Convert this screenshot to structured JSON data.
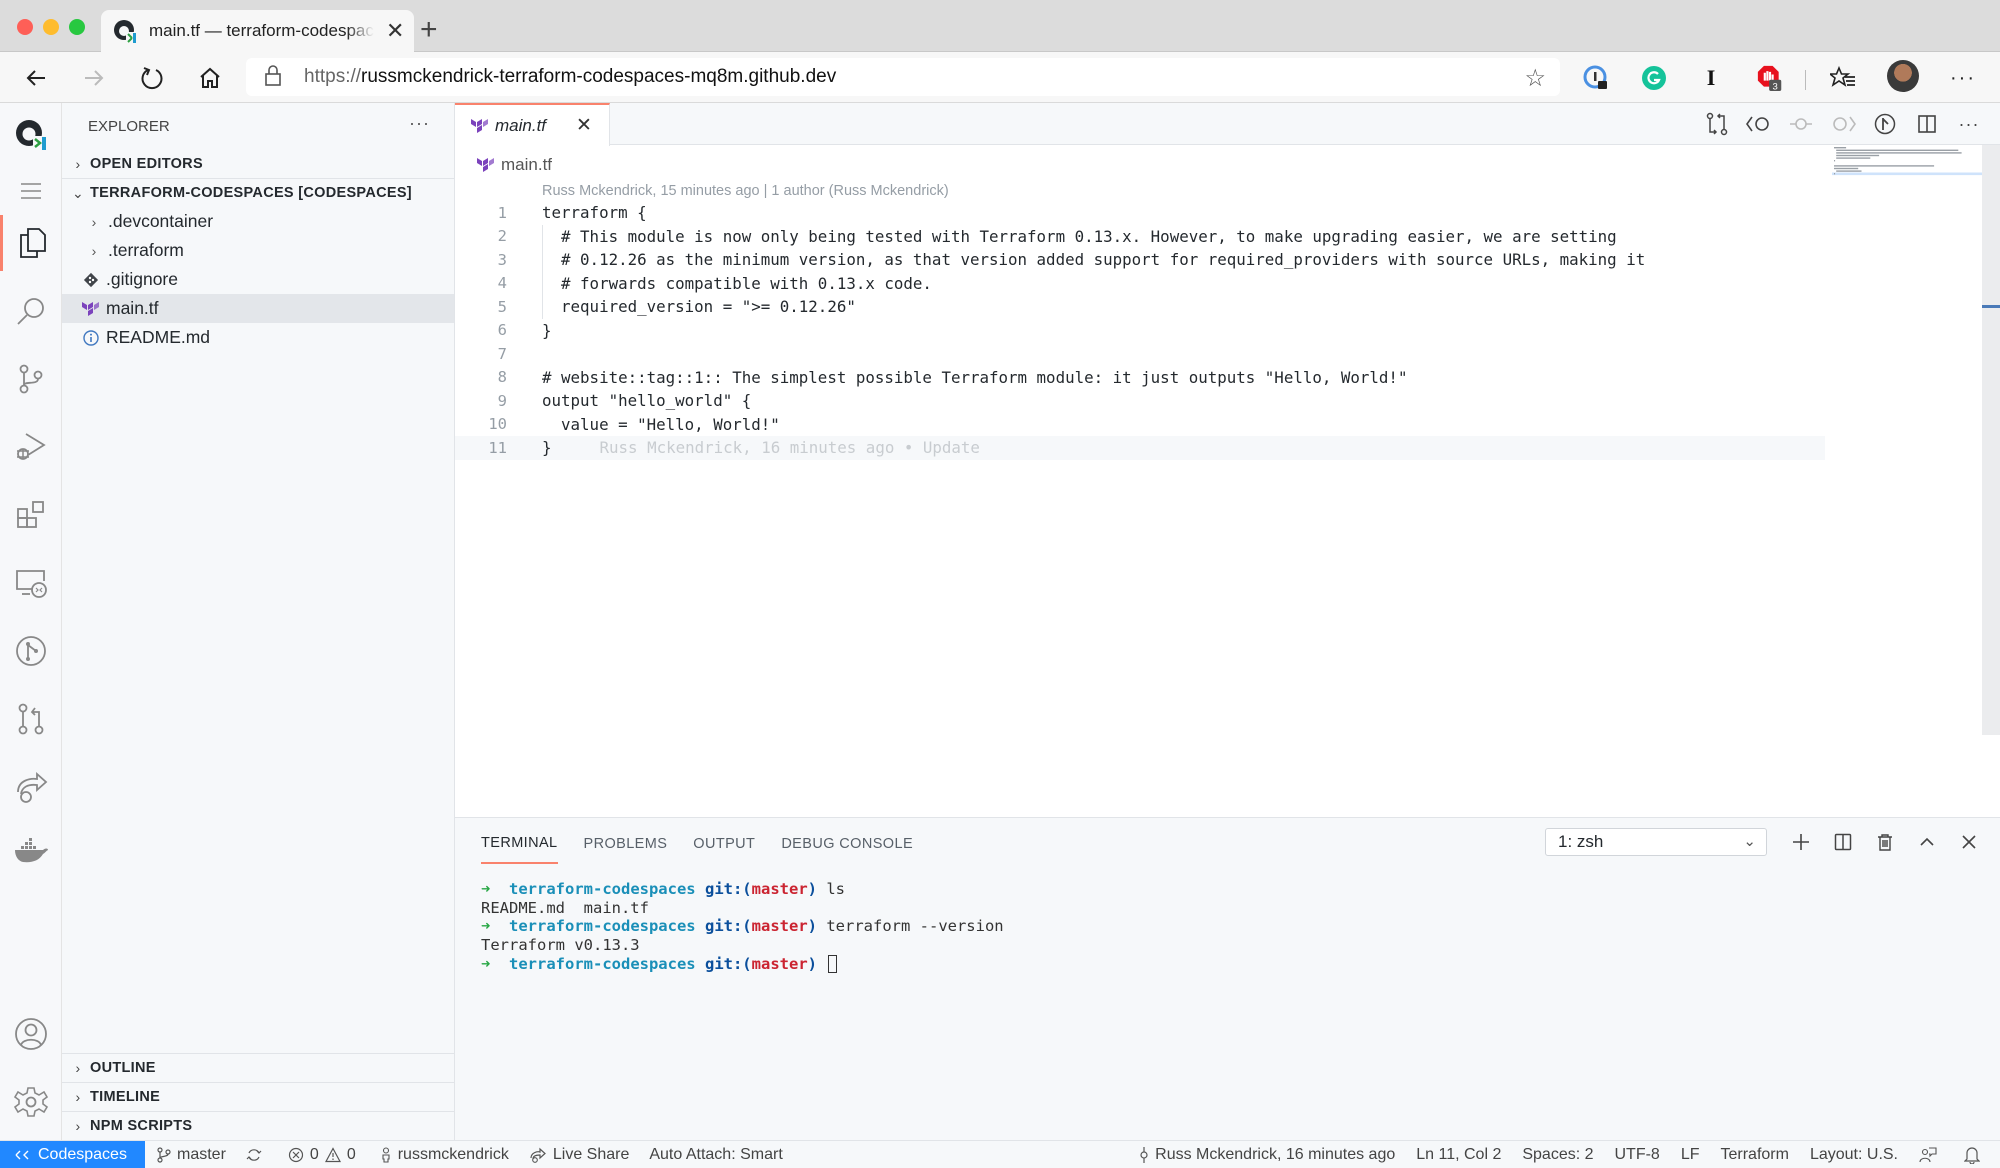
{
  "browser": {
    "tab_title": "main.tf — terraform-codespaces",
    "url_protocol": "https://",
    "url_host": "russmckendrick-terraform-codespaces-mq8m.github.dev",
    "extensions": [
      {
        "name": "password-manager-icon"
      },
      {
        "name": "grammarly-icon"
      },
      {
        "name": "instapaper-icon",
        "label": "I"
      },
      {
        "name": "adblock-icon",
        "badge": "3"
      }
    ]
  },
  "activitybar": {
    "items": [
      "explorer",
      "search",
      "source-control",
      "run-debug",
      "extensions",
      "remote-explorer",
      "github",
      "pull-requests",
      "live-share",
      "docker"
    ],
    "bottom": [
      "accounts",
      "manage"
    ]
  },
  "sidebar": {
    "title": "EXPLORER",
    "more": "···",
    "open_editors": "OPEN EDITORS",
    "workspace": "TERRAFORM-CODESPACES [CODESPACES]",
    "tree": [
      {
        "label": ".devcontainer",
        "type": "folder"
      },
      {
        "label": ".terraform",
        "type": "folder"
      },
      {
        "label": ".gitignore",
        "type": "git"
      },
      {
        "label": "main.tf",
        "type": "terraform",
        "selected": true
      },
      {
        "label": "README.md",
        "type": "info"
      }
    ],
    "bottom_sections": [
      "OUTLINE",
      "TIMELINE",
      "NPM SCRIPTS"
    ]
  },
  "editor": {
    "tab_label": "main.tf",
    "breadcrumb": "main.tf",
    "codelens": "Russ Mckendrick, 15 minutes ago | 1 author (Russ Mckendrick)",
    "lines": [
      {
        "n": "1",
        "text": "terraform {"
      },
      {
        "n": "2",
        "text": "  # This module is now only being tested with Terraform 0.13.x. However, to make upgrading easier, we are setting"
      },
      {
        "n": "3",
        "text": "  # 0.12.26 as the minimum version, as that version added support for required_providers with source URLs, making it"
      },
      {
        "n": "4",
        "text": "  # forwards compatible with 0.13.x code."
      },
      {
        "n": "5",
        "text": "  required_version = \">= 0.12.26\""
      },
      {
        "n": "6",
        "text": "}"
      },
      {
        "n": "7",
        "text": ""
      },
      {
        "n": "8",
        "text": "# website::tag::1:: The simplest possible Terraform module: it just outputs \"Hello, World!\""
      },
      {
        "n": "9",
        "text": "output \"hello_world\" {"
      },
      {
        "n": "10",
        "text": "  value = \"Hello, World!\""
      },
      {
        "n": "11",
        "text": "}",
        "blame": "Russ Mckendrick, 16 minutes ago • Update",
        "current": true
      }
    ]
  },
  "panel": {
    "tabs": [
      "TERMINAL",
      "PROBLEMS",
      "OUTPUT",
      "DEBUG CONSOLE"
    ],
    "active_tab": "TERMINAL",
    "terminal_select": "1: zsh",
    "terminal": [
      {
        "type": "prompt",
        "dir": "terraform-codespaces",
        "git": "git:(",
        "branch": "master",
        "git_close": ")",
        "cmd": " ls"
      },
      {
        "type": "output",
        "text": "README.md  main.tf"
      },
      {
        "type": "prompt",
        "dir": "terraform-codespaces",
        "git": "git:(",
        "branch": "master",
        "git_close": ")",
        "cmd": " terraform --version"
      },
      {
        "type": "output",
        "text": "Terraform v0.13.3"
      },
      {
        "type": "prompt",
        "dir": "terraform-codespaces",
        "git": "git:(",
        "branch": "master",
        "git_close": ")",
        "cmd": " "
      }
    ]
  },
  "statusbar": {
    "remote": "Codespaces",
    "branch": "master",
    "errors": "0",
    "warnings": "0",
    "user": "russmckendrick",
    "live_share": "Live Share",
    "auto_attach": "Auto Attach: Smart",
    "blame": "Russ Mckendrick, 16 minutes ago",
    "position": "Ln 11, Col 2",
    "spaces": "Spaces: 2",
    "encoding": "UTF-8",
    "eol": "LF",
    "language": "Terraform",
    "layout": "Layout: U.S."
  },
  "colors": {
    "accent": "#f9826c",
    "remote_bg": "#2188ff",
    "terraform_purple": "#7b42bc"
  }
}
